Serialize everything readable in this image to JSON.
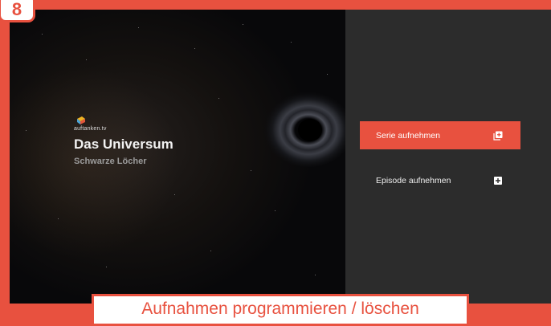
{
  "step_tag": "8",
  "video": {
    "channel_logo_text": "auftanken.tv",
    "title": "Das Universum",
    "subtitle": "Schwarze Löcher"
  },
  "menu": {
    "series_label": "Serie aufnehmen",
    "episode_label": "Episode aufnehmen",
    "series_icon": "add-multiple-icon",
    "episode_icon": "add-icon"
  },
  "caption": "Aufnahmen programmieren / löschen",
  "colors": {
    "accent": "#e8513f",
    "panel": "#2c2c2c",
    "video_bg": "#0d0d0f"
  }
}
